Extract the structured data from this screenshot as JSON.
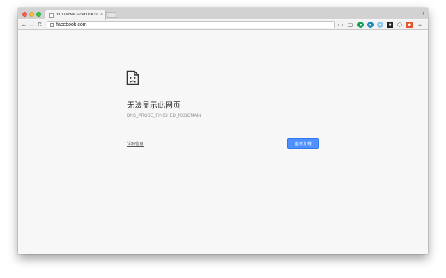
{
  "tab": {
    "title": "http://www.facebook.com/ -",
    "close_glyph": "×"
  },
  "tabstrip": {
    "overflow_glyph": "›"
  },
  "toolbar": {
    "back_glyph": "←",
    "forward_glyph": "→",
    "reload_glyph": "C",
    "url": "facebook.com",
    "menu_glyph": "≡"
  },
  "extensions": [
    "cast-icon",
    "monitor-icon",
    "green-extension-icon",
    "teal-extension-icon",
    "lightblue-extension-icon",
    "dark-extension-icon",
    "shield-icon",
    "colorful-extension-icon"
  ],
  "error": {
    "title": "无法显示此网页",
    "code": "DNS_PROBE_FINISHED_NXDOMAIN",
    "details_link": "详细信息",
    "reload_button": "重新加载"
  },
  "colors": {
    "reload_button_bg": "#4d90fe",
    "page_bg": "#f7f7f7"
  }
}
